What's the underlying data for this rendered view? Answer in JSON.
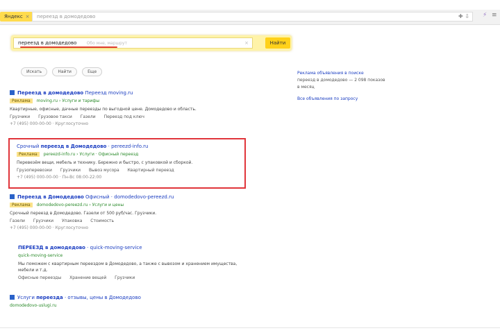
{
  "topbar": {
    "logo_label": "Яндекс",
    "url_text": "переезд в домодедово",
    "url_icons": "✚ ⇩",
    "fav_icon": "lightning-icon",
    "menu_icon": "menu-icon"
  },
  "search": {
    "query": "переезд в домодедово",
    "hint": "Обо мне, маршрут",
    "button_label": "Найти"
  },
  "chips": [
    "Искать",
    "Найти",
    "Еще"
  ],
  "results": [
    {
      "title_bold": "Переезд в домодедово",
      "title_rest": " Переезд moving.ru",
      "badge": "Реклама",
      "url": "moving.ru",
      "path": "Услуги и тарифы",
      "snippet": "Квартирные, офисные, дачные переезды по выгодной цене. Домодедово и область.",
      "links": [
        "Грузчики",
        "Грузовое такси",
        "Газели",
        "Переезд под ключ"
      ],
      "meta": "+7 (495) 000-00-00 · Круглосуточно"
    },
    {
      "title_pre": "Срочный ",
      "title_bold": "переезд в Домодедово",
      "title_rest": " · pereezd-info.ru",
      "badge": "Реклама",
      "url": "pereezd-info.ru",
      "path": "Услуги · Офисный переезд",
      "snippet": "Перевезём вещи, мебель и технику. Бережно и быстро, с упаковкой и сборкой.",
      "links": [
        "Грузоперевозки",
        "Грузчики",
        "Вывоз мусора",
        "Квартирный переезд"
      ],
      "meta": "+7 (495) 000-00-00 · Пн-Вс 08:00-22:00"
    },
    {
      "title_bold": "Переезд в Домодедово",
      "title_rest": " Офисный · domodedovo-pereezd.ru",
      "badge": "Реклама",
      "url": "domodedovo-pereezd.ru",
      "path": "Услуги и цены",
      "snippet": "Срочный переезд в Домодедово. Газели от 500 руб/час. Грузчики.",
      "links": [
        "Газели",
        "Грузчики",
        "Упаковка",
        "Стоимость"
      ],
      "meta": "+7 (495) 000-00-00 · Круглосуточно"
    },
    {
      "title_bold": "ПЕРЕЕЗД в домодедово",
      "title_rest": " · quick-moving-service",
      "url": "quick-moving-service",
      "snippet": "Мы поможем с квартирным переездом в Домодедово, а также с вывозом и хранением имущества, мебели и т.д.",
      "links": [
        "Офисные переезды",
        "Хранение вещей",
        "Грузчики"
      ]
    },
    {
      "title_pre": "Услуги ",
      "title_bold": "переезда",
      "title_rest": " · отзывы, цены в Домодедово",
      "url": "domodedovo-uslugi.ru"
    }
  ],
  "aside": {
    "link": "Реклама объявления в поиске",
    "line1": "переезд в домодедово — 2 098 показов",
    "line2": "в месяц",
    "link2": "Все объявления по запросу"
  }
}
